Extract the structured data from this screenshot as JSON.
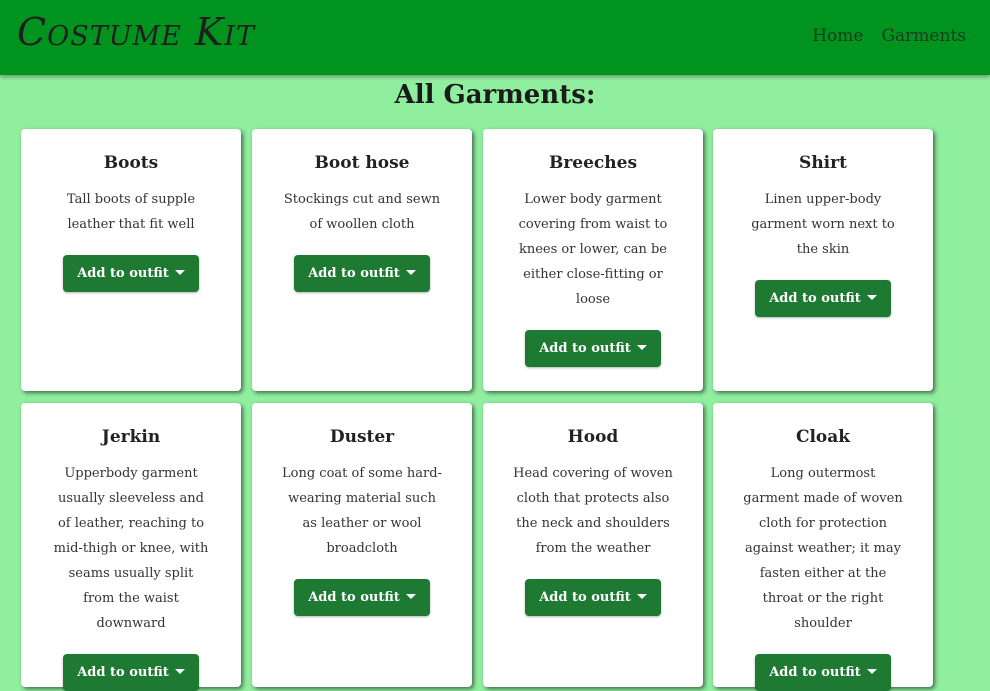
{
  "nav": {
    "brand": "Costume Kit",
    "links": [
      "Home",
      "Garments"
    ]
  },
  "page_title": "All Garments:",
  "button_label": "Add to outfit",
  "garments": [
    {
      "name": "Boots",
      "description": "Tall boots of supple leather that fit well"
    },
    {
      "name": "Boot hose",
      "description": "Stockings cut and sewn of woollen cloth"
    },
    {
      "name": "Breeches",
      "description": "Lower body garment covering from waist to knees or lower, can be either close-fitting or loose"
    },
    {
      "name": "Shirt",
      "description": "Linen upper-body garment worn next to the skin"
    },
    {
      "name": "Jerkin",
      "description": "Upperbody garment usually sleeveless and of leather, reaching to mid-thigh or knee, with seams usually split from the waist downward"
    },
    {
      "name": "Duster",
      "description": "Long coat of some hard-wearing material such as leather or wool broadcloth"
    },
    {
      "name": "Hood",
      "description": "Head covering of woven cloth that protects also the neck and shoulders from the weather"
    },
    {
      "name": "Cloak",
      "description": "Long outermost garment made of woven cloth for protection against weather; it may fasten either at the throat or the right shoulder"
    }
  ]
}
